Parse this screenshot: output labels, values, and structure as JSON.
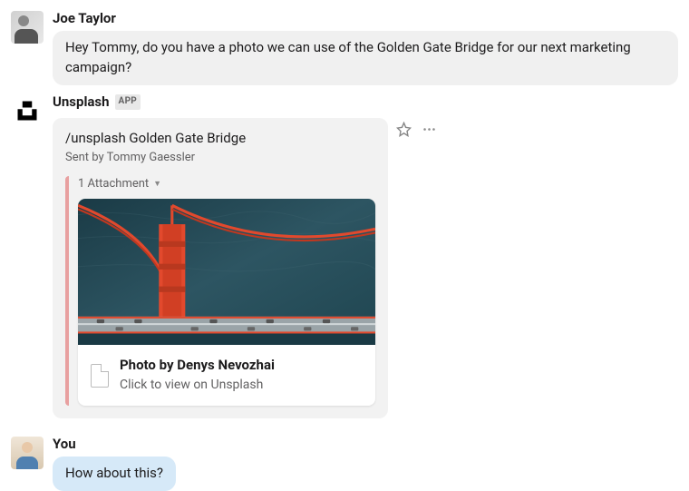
{
  "messages": {
    "joe": {
      "sender": "Joe Taylor",
      "text": "Hey Tommy, do you have a photo we can use of the Golden Gate Bridge for our next marketing campaign?"
    },
    "app": {
      "sender": "Unsplash",
      "badge": "APP",
      "card": {
        "title": "/unsplash Golden Gate Bridge",
        "sub": "Sent by Tommy Gaessler",
        "attachments_label": "1 Attachment",
        "photo_title": "Photo by Denys Nevozhai",
        "photo_sub": "Click to view on Unsplash"
      }
    },
    "you": {
      "sender": "You",
      "text": "How about this?"
    }
  }
}
